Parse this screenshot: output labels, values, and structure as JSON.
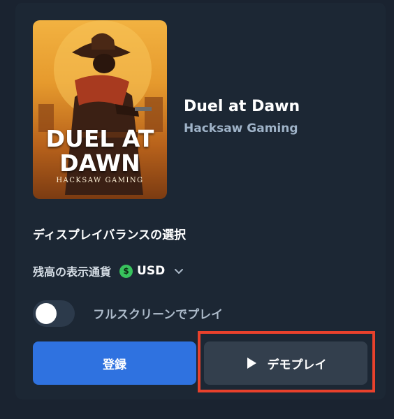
{
  "game": {
    "title": "Duel at Dawn",
    "provider": "Hacksaw Gaming",
    "cover": {
      "title_line1": "DUEL AT",
      "title_line2": "DAWN",
      "studio": "HACKSAW GAMING"
    }
  },
  "balance_section": {
    "label": "ディスプレイバランスの選択"
  },
  "currency": {
    "label": "残高の表示通貨",
    "coin_symbol": "$",
    "value": "USD",
    "coin_color": "#38c35d",
    "icon": "chevron-down-icon"
  },
  "fullscreen": {
    "label": "フルスクリーンでプレイ",
    "enabled": false
  },
  "buttons": {
    "register_label": "登録",
    "demo_label": "デモプレイ",
    "register_color": "#2f72e0",
    "demo_color": "#333f4d"
  },
  "highlight_color": "#e8412c"
}
